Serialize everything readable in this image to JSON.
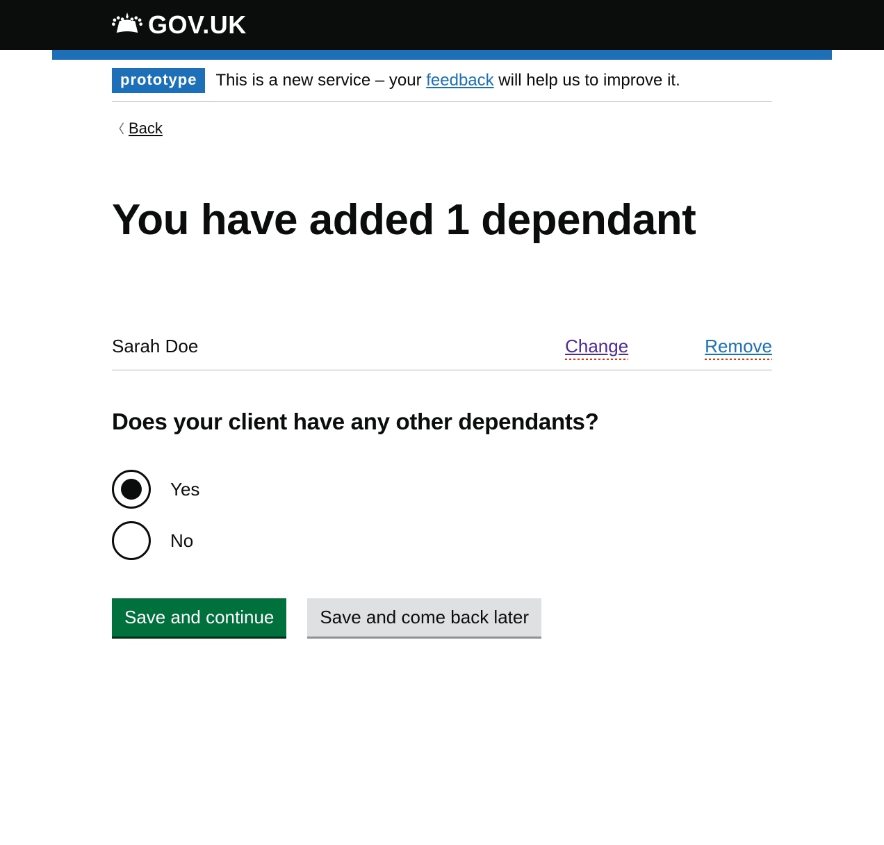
{
  "header": {
    "logo_text": "GOV.UK"
  },
  "phase_banner": {
    "tag": "prototype",
    "text_before": "This is a new service – your ",
    "link_text": "feedback",
    "text_after": " will help us to improve it."
  },
  "back_link": {
    "label": "Back"
  },
  "page": {
    "heading": "You have added 1 dependant"
  },
  "summary": {
    "rows": [
      {
        "name": "Sarah Doe",
        "change_label": "Change",
        "remove_label": "Remove"
      }
    ]
  },
  "question": {
    "legend": "Does your client have any other dependants?",
    "options": [
      {
        "label": "Yes",
        "selected": true
      },
      {
        "label": "No",
        "selected": false
      }
    ]
  },
  "buttons": {
    "primary": "Save and continue",
    "secondary": "Save and come back later"
  }
}
